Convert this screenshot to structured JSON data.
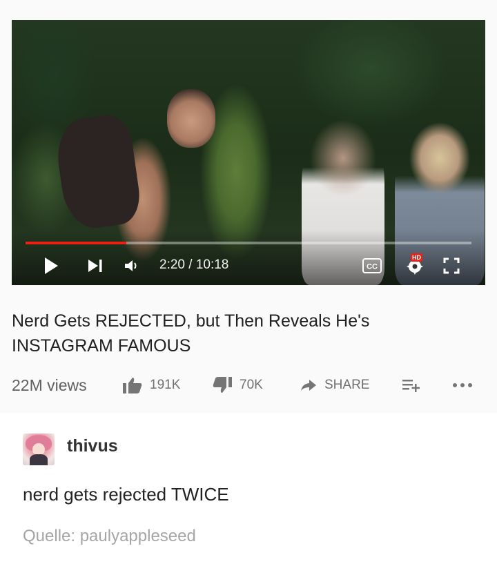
{
  "video": {
    "time_display": "2:20 / 10:18",
    "progress": 0.2265,
    "accent_color": "#e62117",
    "hd_badge": "HD",
    "controls": [
      "play-icon",
      "next-icon",
      "volume-icon",
      "cc-icon",
      "settings-icon",
      "fullscreen-icon"
    ]
  },
  "info": {
    "title": "Nerd Gets REJECTED, but Then Reveals He's INSTAGRAM FAMOUS",
    "views": "22M views",
    "likes": "191K",
    "dislikes": "70K",
    "share_label": "SHARE"
  },
  "post": {
    "username": "thivus",
    "text": "nerd gets rejected TWICE",
    "source": "Quelle: paulyappleseed"
  }
}
